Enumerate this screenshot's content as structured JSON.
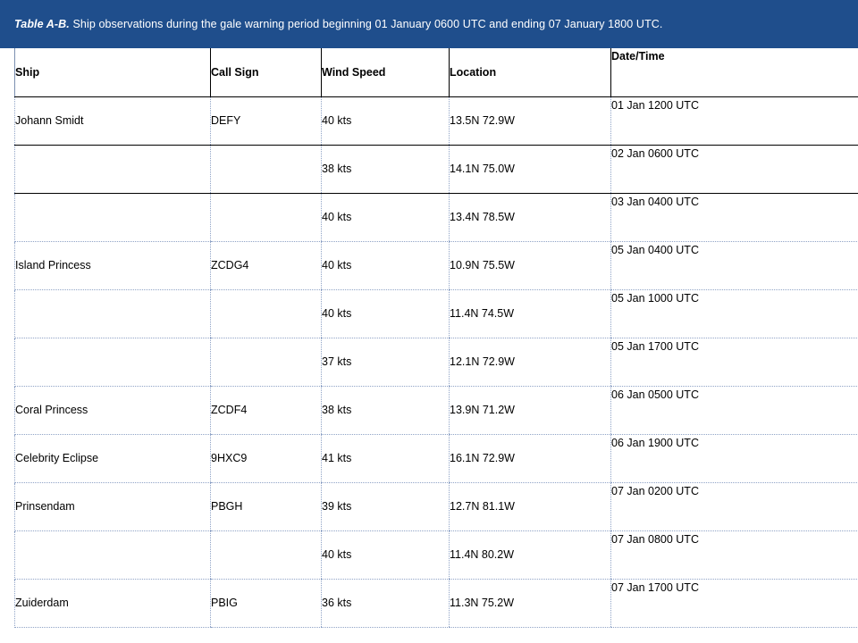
{
  "caption": {
    "label": "Table A-B.",
    "text": " Ship observations during the gale warning  period beginning 01 January 0600  UTC  and ending 07 January  1800 UTC."
  },
  "table": {
    "headers": [
      "Ship",
      "Call Sign",
      "Wind Speed",
      "Location",
      "Date/Time"
    ],
    "rows": [
      {
        "ship": "Johann Smidt",
        "call_sign": "DEFY",
        "wind_speed": "40 kts",
        "location": "13.5N 72.9W",
        "date_time": "01 Jan 1200  UTC"
      },
      {
        "ship": "",
        "call_sign": "",
        "wind_speed": "38 kts",
        "location": "14.1N 75.0W",
        "date_time": "02 Jan 0600  UTC"
      },
      {
        "ship": "",
        "call_sign": "",
        "wind_speed": "40 kts",
        "location": "13.4N 78.5W",
        "date_time": "03 Jan 0400  UTC"
      },
      {
        "ship": "Island Princess",
        "call_sign": "ZCDG4",
        "wind_speed": "40 kts",
        "location": "10.9N 75.5W",
        "date_time": "05 Jan 0400  UTC"
      },
      {
        "ship": "",
        "call_sign": "",
        "wind_speed": "40 kts",
        "location": "11.4N 74.5W",
        "date_time": "05 Jan 1000  UTC"
      },
      {
        "ship": "",
        "call_sign": "",
        "wind_speed": "37 kts",
        "location": "12.1N 72.9W",
        "date_time": "05 Jan 1700  UTC"
      },
      {
        "ship": "Coral Princess",
        "call_sign": "ZCDF4",
        "wind_speed": "38 kts",
        "location": "13.9N 71.2W",
        "date_time": "06 Jan 0500  UTC"
      },
      {
        "ship": "Celebrity Eclipse",
        "call_sign": "9HXC9",
        "wind_speed": "41 kts",
        "location": "16.1N 72.9W",
        "date_time": "06 Jan 1900  UTC"
      },
      {
        "ship": "Prinsendam",
        "call_sign": "PBGH",
        "wind_speed": "39 kts",
        "location": "12.7N 81.1W",
        "date_time": "07 Jan 0200  UTC"
      },
      {
        "ship": "",
        "call_sign": "",
        "wind_speed": "40 kts",
        "location": "11.4N 80.2W",
        "date_time": "07 Jan 0800  UTC"
      },
      {
        "ship": "Zuiderdam",
        "call_sign": "PBIG",
        "wind_speed": "36 kts",
        "location": "11.3N 75.2W",
        "date_time": "07 Jan 1700  UTC"
      }
    ]
  },
  "colors": {
    "caption_background": "#1f4e8c",
    "caption_text": "#ffffff",
    "grid_lines": "#8fa3c6"
  }
}
